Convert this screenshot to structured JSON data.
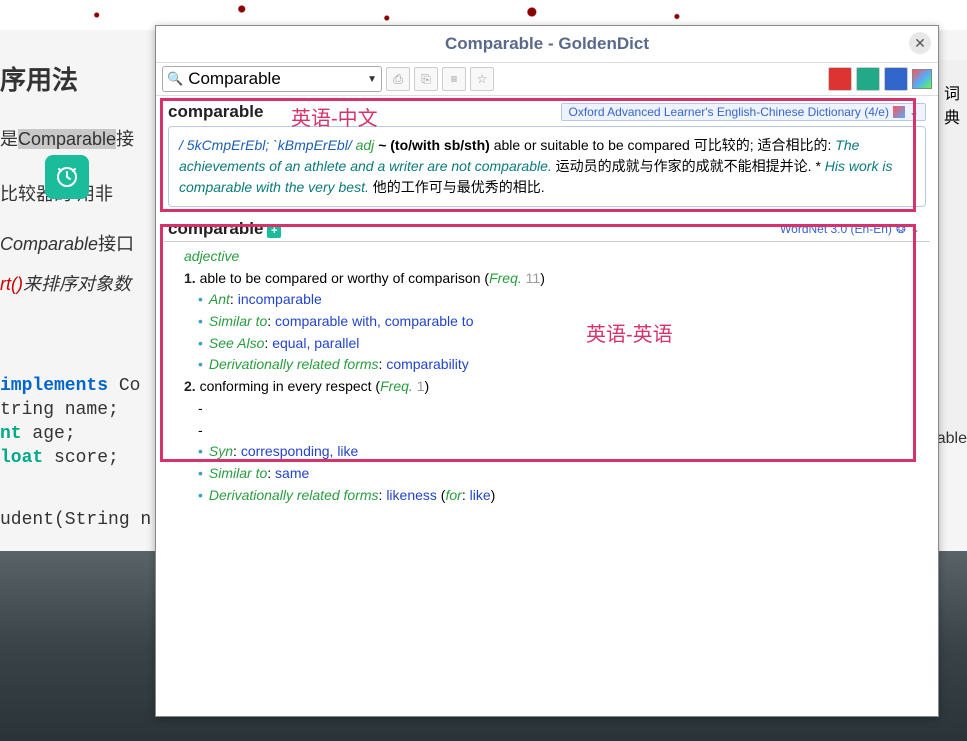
{
  "window": {
    "title": "Comparable - GoldenDict"
  },
  "search": {
    "value": "Comparable"
  },
  "annot": {
    "label1": "英语-中文",
    "label2": "英语-英语"
  },
  "oxford": {
    "headword": "comparable",
    "badge": "Oxford Advanced Learner's English-Chinese Dictionary (4/e)",
    "phon": "/ 5kCmpErEbl; `kBmpErEbl/",
    "pos": "adj",
    "pattern": "~ (to/with sb/sth)",
    "def_en": "able or suitable to be compared",
    "def_zh": "可比较的; 适合相比的:",
    "ex1": "The achievements of an athlete and a writer are not comparable.",
    "ex1_zh": "运动员的成就与作家的成就不能相提并论. *",
    "ex2": "His work is comparable with the very best.",
    "ex2_zh": "他的工作可与最优秀的相比."
  },
  "wordnet": {
    "headword": "comparable",
    "badge": "WordNet 3.0 (En-En)",
    "pos": "adjective",
    "senses": [
      {
        "num": "1.",
        "def": "able to be compared or worthy of comparison",
        "freq": "11",
        "rels": [
          {
            "label": "Ant",
            "links": "incomparable"
          },
          {
            "label": "Similar to",
            "links": "comparable with, comparable to"
          },
          {
            "label": "See Also",
            "links": "equal, parallel"
          },
          {
            "label": "Derivationally related forms",
            "links": "comparability"
          }
        ]
      },
      {
        "num": "2.",
        "def": "conforming in every respect",
        "freq": "1",
        "dashes": [
          "-",
          "-"
        ],
        "rels": [
          {
            "label": "Syn",
            "links": "corresponding, like"
          },
          {
            "label": "Similar to",
            "links": "same"
          },
          {
            "label": "Derivationally related forms",
            "links": "likeness",
            "extra_for": "like"
          }
        ]
      }
    ]
  },
  "bg": {
    "heading": "序用法",
    "line1a": "是",
    "line1b": "Comparable",
    "line1c": "接",
    "line2": "比较器的 用非",
    "line3a": "Comparable",
    "line3b": "接口",
    "line4a": "rt()",
    "line4b": "来排序对象数",
    "code": {
      "impl": "implements",
      "co": "Co",
      "str": "tring name;",
      "nt": "nt",
      "age": " age;",
      "loat": "loat",
      "score": " score;",
      "udent": "udent(String n"
    },
    "side": {
      "dict": "词典",
      "rable": "rable"
    }
  }
}
